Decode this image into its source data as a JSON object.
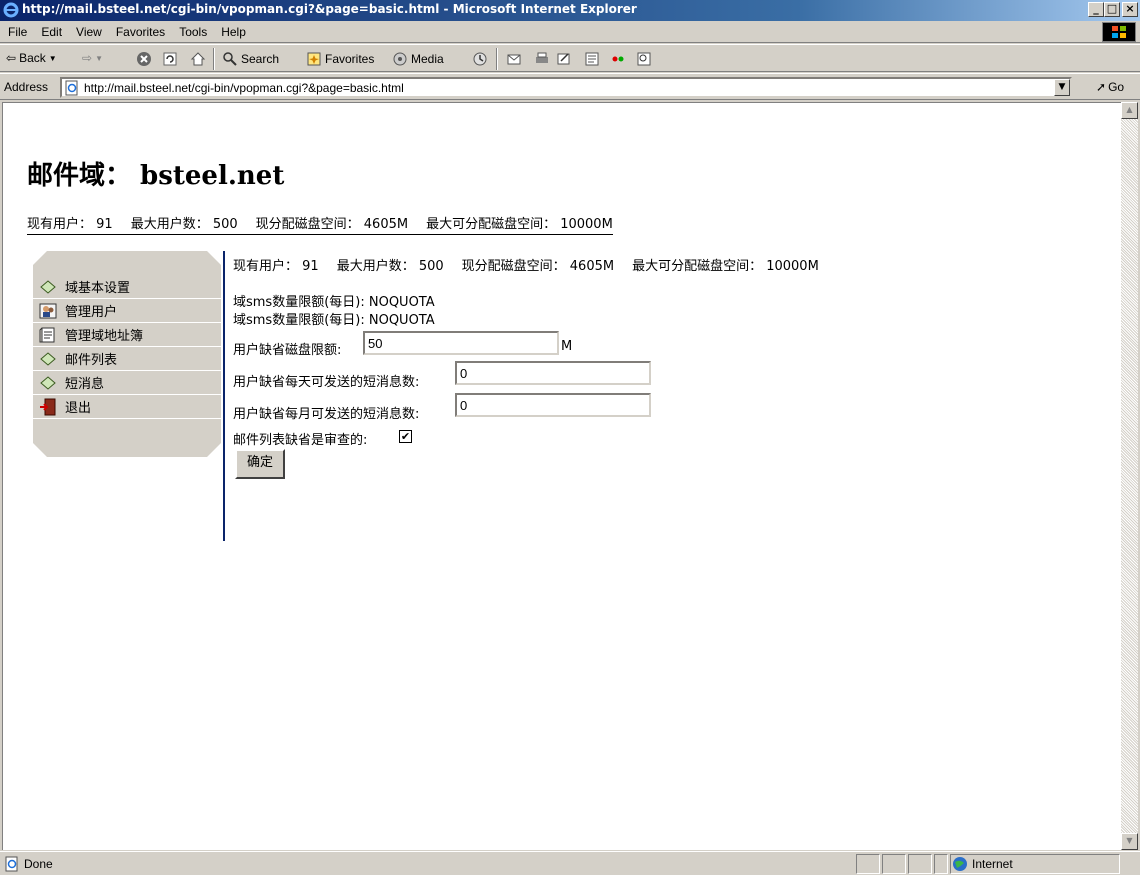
{
  "window": {
    "title": "http://mail.bsteel.net/cgi-bin/vpopman.cgi?&page=basic.html - Microsoft Internet Explorer",
    "min": "_",
    "max": "□",
    "close": "×"
  },
  "menu": {
    "file": "File",
    "edit": "Edit",
    "view": "View",
    "favorites": "Favorites",
    "tools": "Tools",
    "help": "Help"
  },
  "toolbar": {
    "back": "Back",
    "search": "Search",
    "favorites": "Favorites",
    "media": "Media"
  },
  "address": {
    "label": "Address",
    "url": "http://mail.bsteel.net/cgi-bin/vpopman.cgi?&page=basic.html",
    "go": "Go"
  },
  "page": {
    "title": "邮件域： bsteel.net",
    "stats": {
      "current_users": "现有用户： 91",
      "max_users": "最大用户数： 500",
      "allocated_disk": "现分配磁盘空间： 4605M",
      "max_disk": "最大可分配磁盘空间： 10000M"
    },
    "sidebar": [
      {
        "label": "域基本设置",
        "icon": "diamond-icon"
      },
      {
        "label": "管理用户",
        "icon": "users-icon"
      },
      {
        "label": "管理域地址簿",
        "icon": "addressbook-icon"
      },
      {
        "label": "邮件列表",
        "icon": "diamond-icon"
      },
      {
        "label": "短消息",
        "icon": "diamond-icon"
      },
      {
        "label": "退出",
        "icon": "exit-door-icon"
      }
    ],
    "form": {
      "stats": {
        "current_users": "现有用户： 91",
        "max_users": "最大用户数： 500",
        "allocated_disk": "现分配磁盘空间： 4605M",
        "max_disk": "最大可分配磁盘空间： 10000M"
      },
      "sms_daily_1": "域sms数量限额(每日): NOQUOTA",
      "sms_daily_2": "域sms数量限额(每日): NOQUOTA",
      "disk_quota_label": "用户缺省磁盘限额:",
      "disk_quota_value": "50",
      "disk_quota_unit": "M",
      "daily_sms_label": "用户缺省每天可发送的短消息数:",
      "daily_sms_value": "0",
      "monthly_sms_label": "用户缺省每月可发送的短消息数:",
      "monthly_sms_value": "0",
      "list_moderated_label": "邮件列表缺省是审查的:",
      "list_moderated_checked": "✔",
      "submit": "确定"
    }
  },
  "status": {
    "text": "Done",
    "zone": "Internet"
  }
}
